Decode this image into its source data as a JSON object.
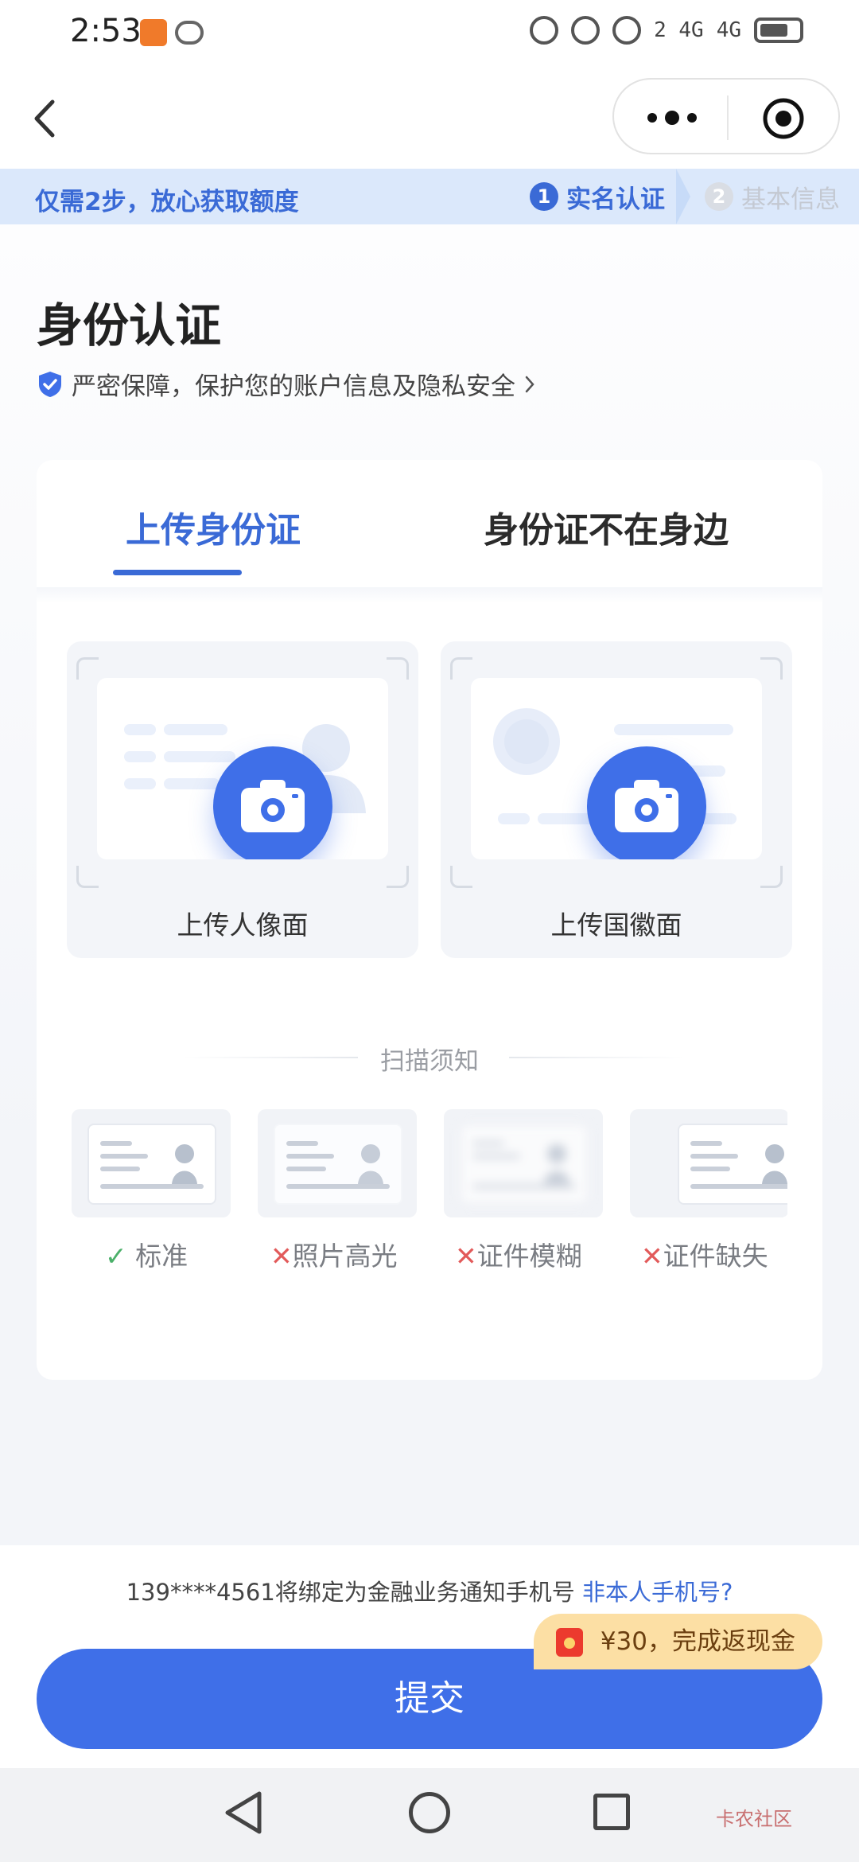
{
  "status_bar": {
    "time": "2:53",
    "signal_1": "2 4G",
    "signal_2": "4G"
  },
  "nav": {
    "back_icon": "chevron-left-icon",
    "more_icon": "more-dots-icon",
    "close_icon": "target-icon"
  },
  "banner": {
    "text": "仅需2步，放心获取额度",
    "steps": [
      {
        "num": "1",
        "label": "实名认证",
        "active": true
      },
      {
        "num": "2",
        "label": "基本信息",
        "active": false
      }
    ]
  },
  "page": {
    "title": "身份认证",
    "security_note": "严密保障，保护您的账户信息及隐私安全"
  },
  "tabs": [
    {
      "label": "上传身份证",
      "active": true
    },
    {
      "label": "身份证不在身边",
      "active": false
    }
  ],
  "uploads": {
    "front_label": "上传人像面",
    "back_label": "上传国徽面"
  },
  "scan_notice": {
    "title": "扫描须知",
    "items": [
      {
        "mark": "✓",
        "label": "标准"
      },
      {
        "mark": "✕",
        "label": "照片高光"
      },
      {
        "mark": "✕",
        "label": "证件模糊"
      },
      {
        "mark": "✕",
        "label": "证件缺失"
      }
    ]
  },
  "footer": {
    "phone_note": "139****4561将绑定为金融业务通知手机号",
    "phone_link": "非本人手机号?",
    "cashback": "¥30，完成返现金",
    "submit_label": "提交"
  },
  "colors": {
    "accent": "#3f6fe8",
    "banner_bg": "#dbe8fb",
    "cashback_bg": "#fcdfa4"
  },
  "watermark": "卡农社区"
}
